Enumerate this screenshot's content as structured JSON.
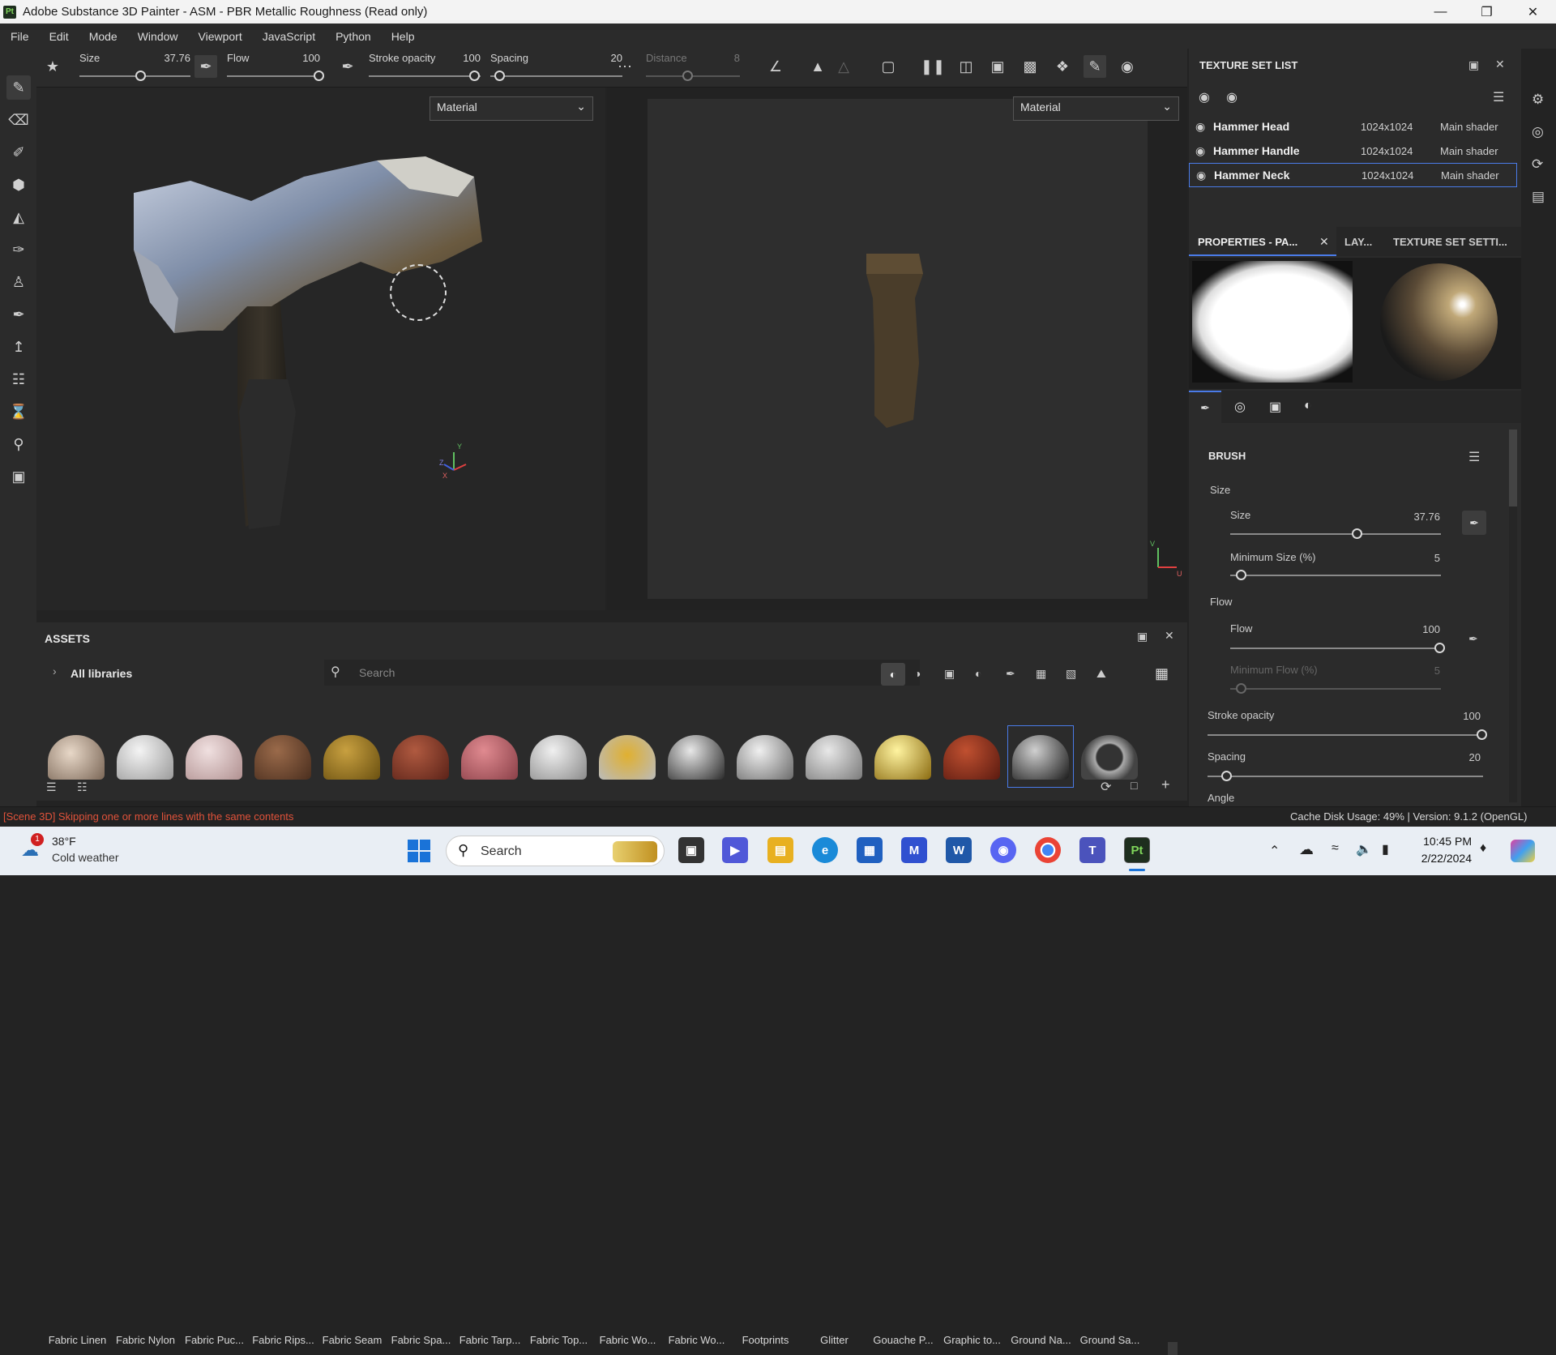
{
  "window": {
    "title": "Adobe Substance 3D Painter - ASM - PBR Metallic Roughness (Read only)",
    "app_icon": "Pt"
  },
  "menu": [
    "File",
    "Edit",
    "Mode",
    "Window",
    "Viewport",
    "JavaScript",
    "Python",
    "Help"
  ],
  "toolbar": {
    "size_label": "Size",
    "size_value": "37.76",
    "flow_label": "Flow",
    "flow_value": "100",
    "stroke_label": "Stroke opacity",
    "stroke_value": "100",
    "spacing_label": "Spacing",
    "spacing_value": "20",
    "distance_label": "Distance",
    "distance_value": "8"
  },
  "viewport3d": {
    "mode": "Material",
    "axis_y": "Y",
    "axis_z": "Z",
    "axis_x": "X"
  },
  "viewport2d": {
    "mode": "Material",
    "axis_v": "V",
    "axis_u": "U"
  },
  "texture_set_list": {
    "title": "TEXTURE SET LIST",
    "items": [
      {
        "name": "Hammer Head",
        "resolution": "1024x1024",
        "shader": "Main shader"
      },
      {
        "name": "Hammer Handle",
        "resolution": "1024x1024",
        "shader": "Main shader"
      },
      {
        "name": "Hammer Neck",
        "resolution": "1024x1024",
        "shader": "Main shader"
      }
    ]
  },
  "panel_tabs": {
    "properties": "PROPERTIES - PA...",
    "layers": "LAY...",
    "texture_set_settings": "TEXTURE SET SETTI..."
  },
  "brush": {
    "title": "BRUSH",
    "size_group": "Size",
    "size_label": "Size",
    "size_value": "37.76",
    "size_fraction": 0.6,
    "min_size_label": "Minimum Size (%)",
    "min_size_value": "5",
    "flow_group": "Flow",
    "flow_label": "Flow",
    "flow_value": "100",
    "min_flow_label": "Minimum Flow (%)",
    "min_flow_value": "5",
    "stroke_label": "Stroke opacity",
    "stroke_value": "100",
    "spacing_label": "Spacing",
    "spacing_value": "20",
    "angle_label": "Angle"
  },
  "assets": {
    "title": "ASSETS",
    "library": "All libraries",
    "search_placeholder": "Search",
    "top_labels": [
      "Fabric Linen",
      "Fabric Nylon",
      "Fabric Puc...",
      "Fabric Rips...",
      "Fabric Seam",
      "Fabric Spa...",
      "Fabric Tarp...",
      "Fabric Top...",
      "Fabric Wo...",
      "Fabric Wo...",
      "Footprints",
      "Glitter",
      "Gouache P...",
      "Graphic to...",
      "Ground Na...",
      "Ground Sa..."
    ]
  },
  "status": {
    "message": "[Scene 3D] Skipping one or more lines with the same contents",
    "cache": "Cache Disk Usage:  49% | Version: 9.1.2 (OpenGL)"
  },
  "taskbar": {
    "weather_temp": "38°F",
    "weather_desc": "Cold weather",
    "weather_badge": "1",
    "search": "Search",
    "time": "10:45 PM",
    "date": "2/22/2024"
  },
  "colors": {
    "accent": "#4a7be8",
    "status_error": "#e0523a",
    "panel_bg": "#2b2b2b"
  }
}
